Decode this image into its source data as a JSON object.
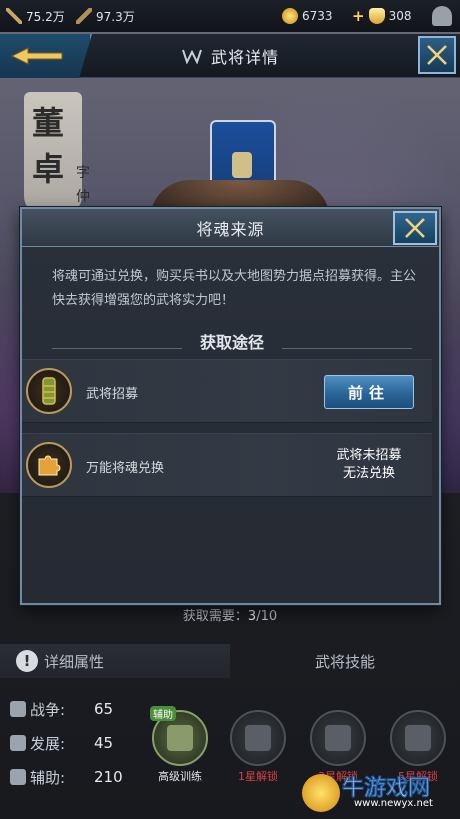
{
  "top_bar": {
    "resource_1": "75.2万",
    "resource_2": "97.3万",
    "coins": "6733",
    "gold": "308"
  },
  "header": {
    "title": "武将详情"
  },
  "hero": {
    "name_chars": [
      "董",
      "卓"
    ],
    "name_sub": [
      "字",
      "仲"
    ]
  },
  "modal": {
    "title": "将魂来源",
    "description": "将魂可通过兑换，购买兵书以及大地图势力据点招募获得。主公快去获得增强您的武将实力吧！",
    "section_title": "获取途径",
    "sources": [
      {
        "label": "武将招募",
        "button_label": "前往"
      },
      {
        "label": "万能将魂兑换",
        "status_line1": "武将未招募",
        "status_line2": "无法兑换"
      }
    ]
  },
  "progress": {
    "label": "获取需要：",
    "current": "3",
    "total": "/10"
  },
  "tabs": {
    "detail": "详细属性",
    "skills": "武将技能"
  },
  "stats": [
    {
      "label": "战争:",
      "value": "65"
    },
    {
      "label": "发展:",
      "value": "45"
    },
    {
      "label": "辅助:",
      "value": "210"
    }
  ],
  "skills": {
    "tag": "辅助",
    "items": [
      {
        "label": "高级训练"
      },
      {
        "label": "1星解锁"
      },
      {
        "label": "3星解锁"
      },
      {
        "label": "5星解锁"
      }
    ]
  },
  "watermark": {
    "name": "牛游戏网",
    "url": "www.newyx.net"
  },
  "colors": {
    "accent_blue": "#2a6598",
    "locked_red": "#d94040",
    "frame": "#6f8aa3"
  }
}
